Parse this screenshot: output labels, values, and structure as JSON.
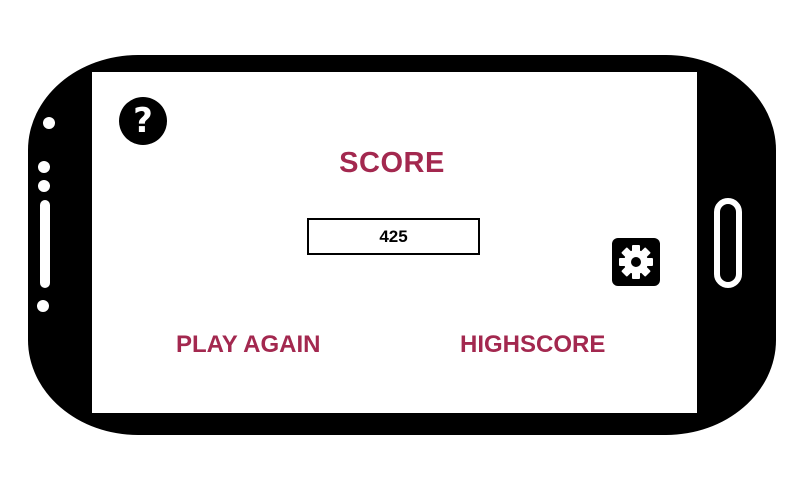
{
  "colors": {
    "accent": "#A3284F",
    "device": "#000000",
    "screen": "#ffffff"
  },
  "help": {
    "glyph": "?",
    "icon": "question-icon"
  },
  "score": {
    "title": "SCORE",
    "value": "425"
  },
  "settings": {
    "icon": "gear-icon"
  },
  "actions": {
    "play_again": "PLAY AGAIN",
    "highscore": "HIGHSCORE"
  }
}
